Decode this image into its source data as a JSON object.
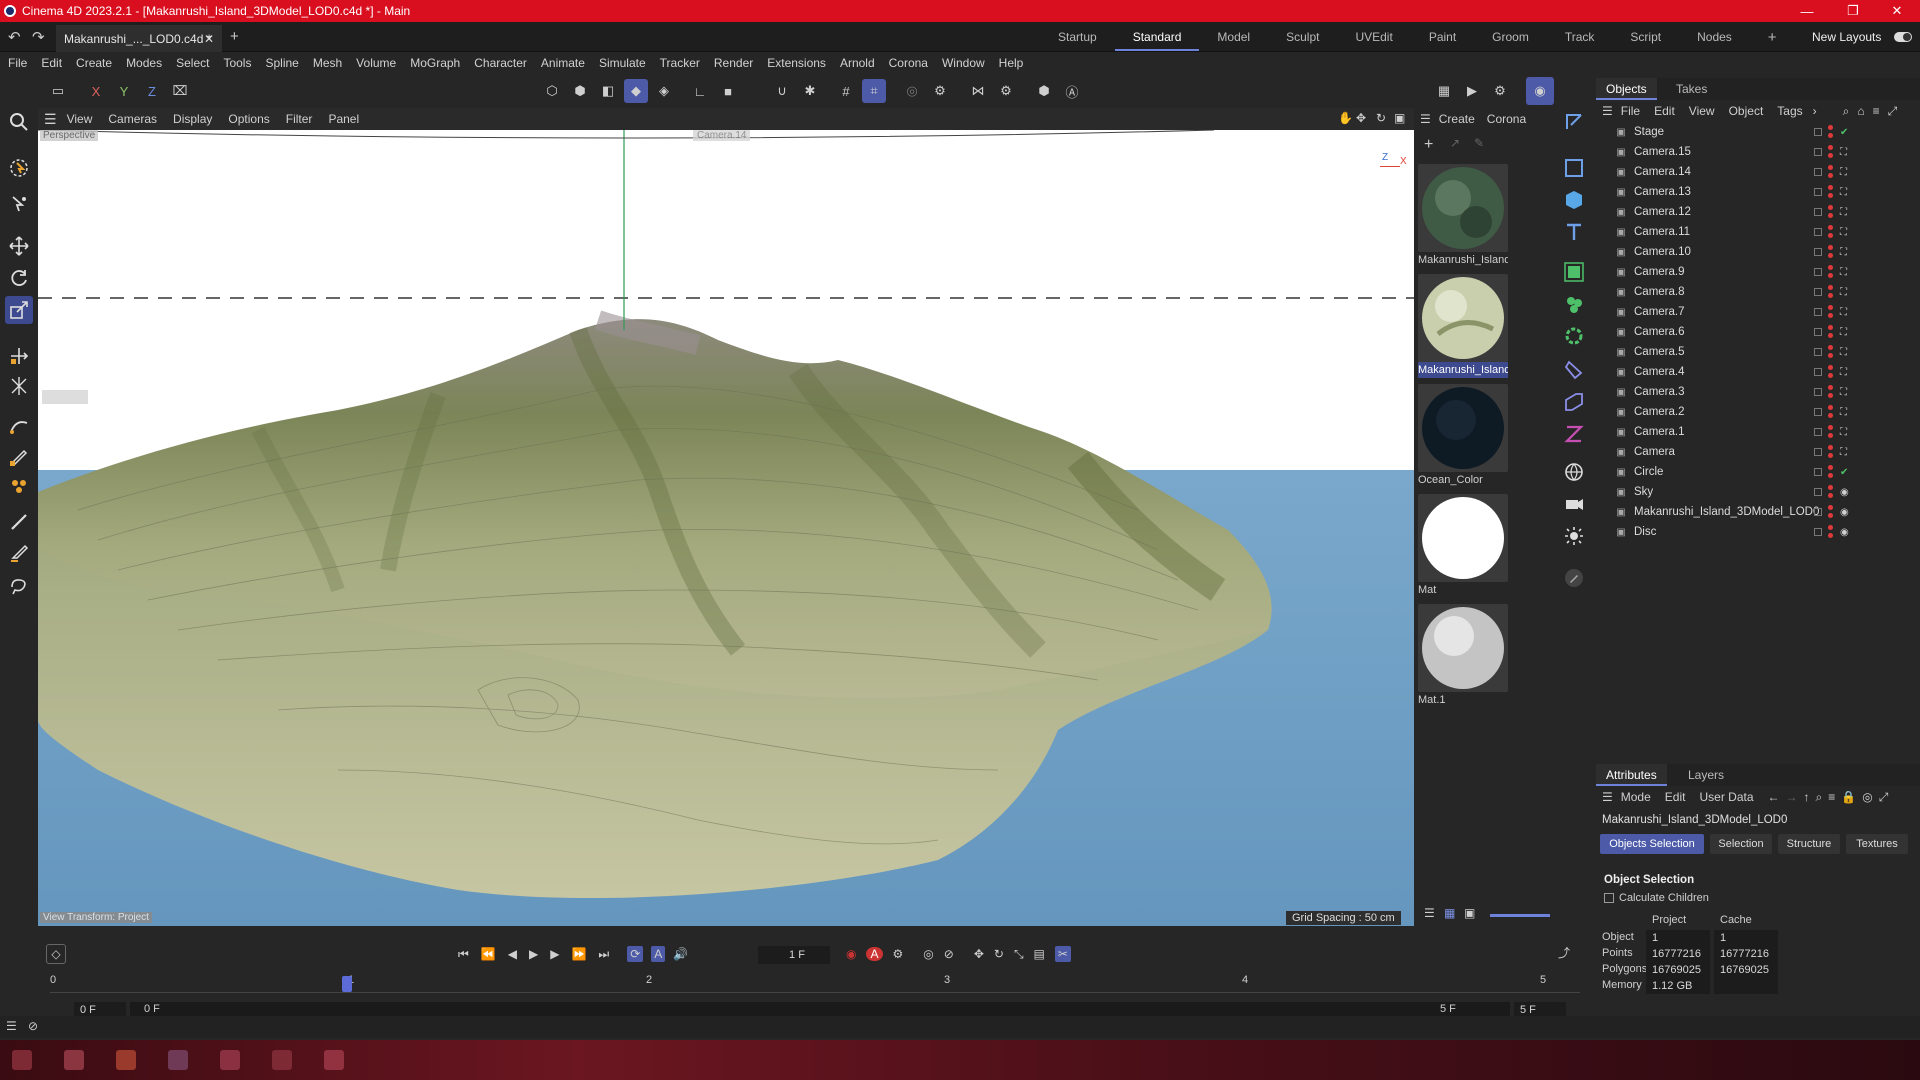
{
  "window": {
    "title": "Cinema 4D 2023.2.1 - [Makanrushi_Island_3DModel_LOD0.c4d *] - Main"
  },
  "doc_tab": {
    "label": "Makanrushi_..._LOD0.c4d *"
  },
  "layouts": [
    "Startup",
    "Standard",
    "Model",
    "Sculpt",
    "UVEdit",
    "Paint",
    "Groom",
    "Track",
    "Script",
    "Nodes"
  ],
  "active_layout": "Standard",
  "new_layouts": "New Layouts",
  "menu": [
    "File",
    "Edit",
    "Create",
    "Modes",
    "Select",
    "Tools",
    "Spline",
    "Mesh",
    "Volume",
    "MoGraph",
    "Character",
    "Animate",
    "Simulate",
    "Tracker",
    "Render",
    "Extensions",
    "Arnold",
    "Corona",
    "Window",
    "Help"
  ],
  "axis_labels": {
    "x": "X",
    "y": "Y",
    "z": "Z"
  },
  "viewport_menu": [
    "View",
    "Cameras",
    "Display",
    "Options",
    "Filter",
    "Panel"
  ],
  "viewport": {
    "label": "Perspective",
    "camera_label": "Camera.14",
    "view_transform": "View Transform: Project",
    "grid_spacing": "Grid Spacing : 50 cm",
    "axis_z": "Z",
    "axis_x": "X"
  },
  "material_menu": [
    "Create",
    "Corona"
  ],
  "materials": [
    {
      "name": "Makanrushi_Island",
      "selected": false
    },
    {
      "name": "Makanrushi_Island",
      "selected": true
    },
    {
      "name": "Ocean_Color",
      "selected": false
    },
    {
      "name": "Mat",
      "selected": false
    },
    {
      "name": "Mat.1",
      "selected": false
    }
  ],
  "objects_panel": {
    "tabs": [
      "Objects",
      "Takes"
    ],
    "menu": [
      "File",
      "Edit",
      "View",
      "Object",
      "Tags"
    ],
    "items": [
      "Stage",
      "Camera.15",
      "Camera.14",
      "Camera.13",
      "Camera.12",
      "Camera.11",
      "Camera.10",
      "Camera.9",
      "Camera.8",
      "Camera.7",
      "Camera.6",
      "Camera.5",
      "Camera.4",
      "Camera.3",
      "Camera.2",
      "Camera.1",
      "Camera",
      "Circle",
      "Sky",
      "Makanrushi_Island_3DModel_LOD0",
      "Disc"
    ]
  },
  "attributes": {
    "tabs": [
      "Attributes",
      "Layers"
    ],
    "menu": [
      "Mode",
      "Edit",
      "User Data"
    ],
    "object_name": "Makanrushi_Island_3DModel_LOD0",
    "subtabs": [
      "Objects Selection",
      "Selection",
      "Structure",
      "Textures"
    ],
    "section": "Object Selection",
    "calc_children": "Calculate Children",
    "col_project": "Project",
    "col_cache": "Cache",
    "rows": [
      {
        "label": "Object",
        "project": "1",
        "cache": "1"
      },
      {
        "label": "Points",
        "project": "16777216",
        "cache": "16777216"
      },
      {
        "label": "Polygons",
        "project": "16769025",
        "cache": "16769025"
      },
      {
        "label": "Memory",
        "project": "1.12 GB",
        "cache": ""
      }
    ]
  },
  "timeline": {
    "current_frame": "1 F",
    "ruler": [
      "0",
      "1",
      "2",
      "3",
      "4",
      "5"
    ],
    "start": "0 F",
    "start2": "0 F",
    "end": "5 F",
    "end2": "5 F"
  },
  "colors": {
    "title": "#d90f1f",
    "accent": "#4c5aa8",
    "ocean": "#6d9ec4",
    "terrain": "#a9b08a"
  }
}
